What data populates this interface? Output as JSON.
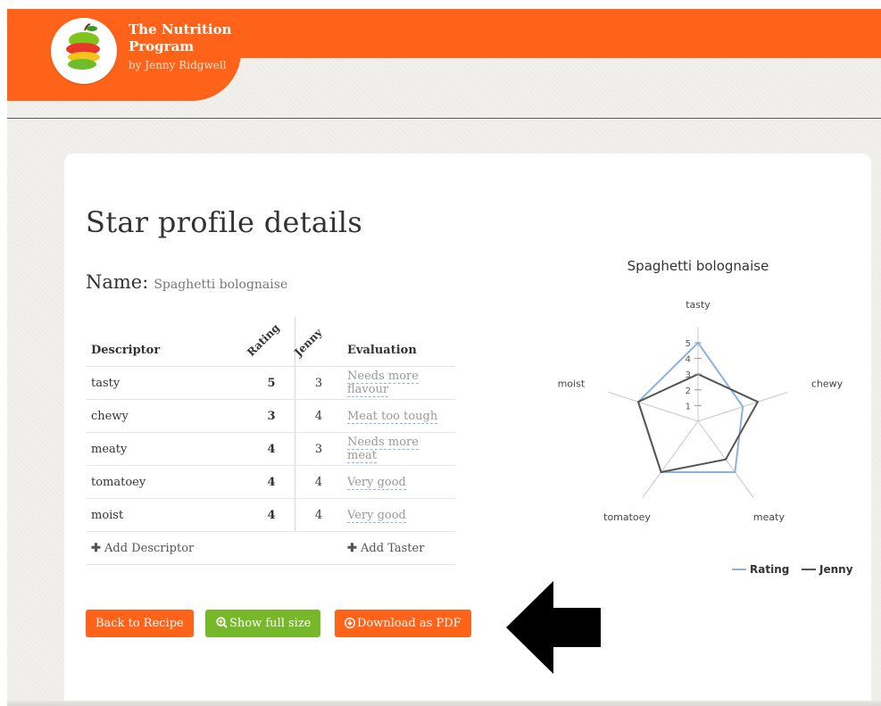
{
  "header": {
    "brand_line1": "The Nutrition",
    "brand_line2": "Program",
    "brand_byline": "by Jenny Ridgwell",
    "accent": "#ff6319"
  },
  "page": {
    "title": "Star profile details",
    "name_label": "Name:",
    "name_value": "Spaghetti bolognaise"
  },
  "table": {
    "headers": {
      "descriptor": "Descriptor",
      "rating": "Rating",
      "jenny": "Jenny",
      "evaluation": "Evaluation"
    },
    "rows": [
      {
        "descriptor": "tasty",
        "rating": "5",
        "jenny": "3",
        "evaluation": "Needs more flavour"
      },
      {
        "descriptor": "chewy",
        "rating": "3",
        "jenny": "4",
        "evaluation": "Meat too tough"
      },
      {
        "descriptor": "meaty",
        "rating": "4",
        "jenny": "3",
        "evaluation": "Needs more meat"
      },
      {
        "descriptor": "tomatoey",
        "rating": "4",
        "jenny": "4",
        "evaluation": "Very good"
      },
      {
        "descriptor": "moist",
        "rating": "4",
        "jenny": "4",
        "evaluation": "Very good"
      }
    ],
    "add_descriptor": "Add Descriptor",
    "add_taster": "Add Taster"
  },
  "buttons": {
    "back": "Back to Recipe",
    "show_full": "Show full size",
    "download": "Download as PDF"
  },
  "chart_data": {
    "type": "radar",
    "title": "Spaghetti bolognaise",
    "categories": [
      "tasty",
      "chewy",
      "meaty",
      "tomatoey",
      "moist"
    ],
    "range": [
      0,
      5
    ],
    "ticks": [
      "1",
      "2",
      "3",
      "4",
      "5"
    ],
    "series": [
      {
        "name": "Rating",
        "values": [
          5,
          3,
          4,
          4,
          4
        ],
        "color": "#8ab4e0"
      },
      {
        "name": "Jenny",
        "values": [
          3,
          4,
          3,
          4,
          4
        ],
        "color": "#555555"
      }
    ],
    "legend_position": "bottom-right"
  }
}
